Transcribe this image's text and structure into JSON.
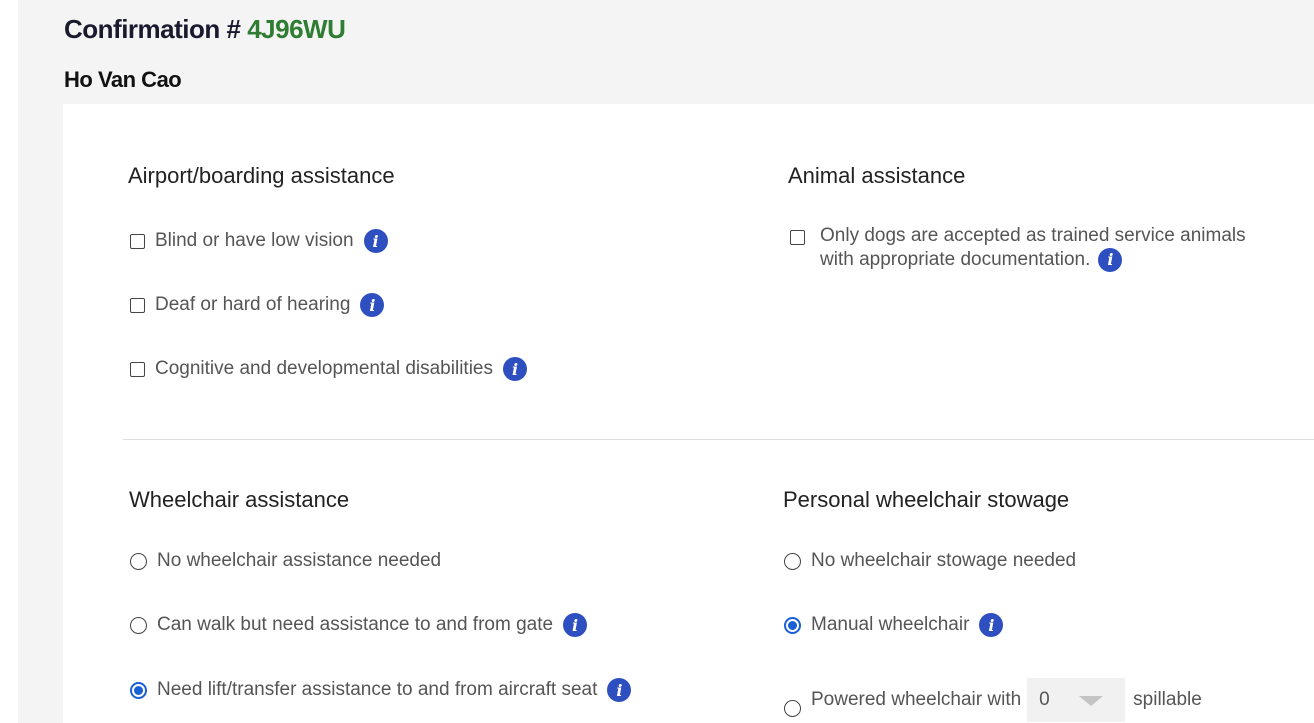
{
  "header": {
    "confirmation_label": "Confirmation #",
    "confirmation_code": "4J96WU",
    "passenger_name": "Ho Van Cao"
  },
  "airport_assistance": {
    "title": "Airport/boarding assistance",
    "options": [
      {
        "label": "Blind or have low vision",
        "checked": false
      },
      {
        "label": "Deaf or hard of hearing",
        "checked": false
      },
      {
        "label": "Cognitive and developmental disabilities",
        "checked": false
      }
    ]
  },
  "animal_assistance": {
    "title": "Animal assistance",
    "option": {
      "label": "Only dogs are accepted as trained service animals with appropriate documentation.",
      "checked": false
    }
  },
  "wheelchair_assistance": {
    "title": "Wheelchair assistance",
    "options": [
      {
        "label": "No wheelchair assistance needed",
        "selected": false
      },
      {
        "label": "Can walk but need assistance to and from gate",
        "selected": false
      },
      {
        "label": "Need lift/transfer assistance to and from aircraft seat",
        "selected": true
      }
    ]
  },
  "wheelchair_stowage": {
    "title": "Personal wheelchair stowage",
    "options": [
      {
        "label": "No wheelchair stowage needed",
        "selected": false
      },
      {
        "label": "Manual wheelchair",
        "selected": true
      },
      {
        "label_before": "Powered wheelchair with",
        "select_value": "0",
        "label_after": "spillable",
        "selected": false
      }
    ]
  },
  "colors": {
    "accent": "#1a5fd6",
    "info_icon": "#2e4fbf",
    "confirmation_code": "#2e7d32"
  },
  "icons": {
    "info": "info-icon",
    "dropdown": "chevron-down-icon"
  }
}
